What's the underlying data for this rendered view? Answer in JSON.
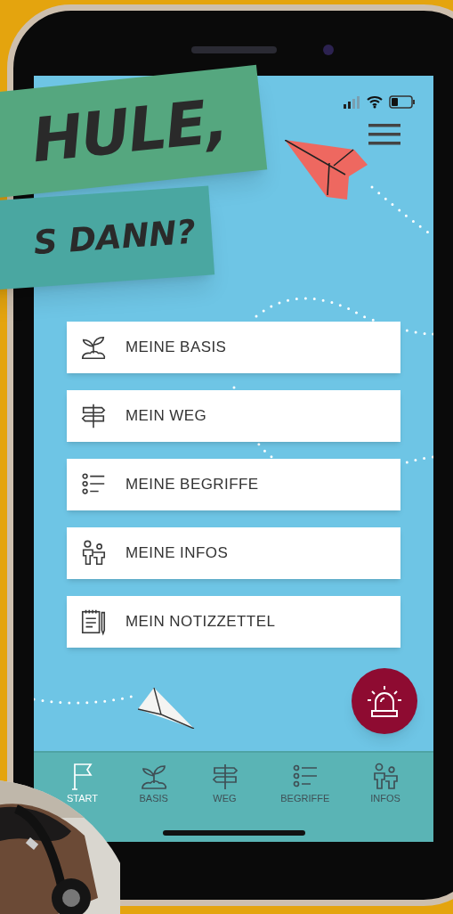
{
  "banner": {
    "line_1": "HULE,",
    "line_2": "S DANN?"
  },
  "menu": [
    {
      "label": "MEINE BASIS",
      "kind": "sprout"
    },
    {
      "label": "MEIN WEG",
      "kind": "signpost"
    },
    {
      "label": "MEINE BEGRIFFE",
      "kind": "list"
    },
    {
      "label": "MEINE INFOS",
      "kind": "people"
    },
    {
      "label": "MEIN NOTIZZETTEL",
      "kind": "notepad"
    }
  ],
  "nav": [
    {
      "label": "START",
      "kind": "flag",
      "selected": true
    },
    {
      "label": "BASIS",
      "kind": "sprout",
      "selected": false
    },
    {
      "label": "WEG",
      "kind": "signpost",
      "selected": false
    },
    {
      "label": "BEGRIFFE",
      "kind": "list",
      "selected": false
    },
    {
      "label": "INFOS",
      "kind": "people",
      "selected": false
    }
  ]
}
